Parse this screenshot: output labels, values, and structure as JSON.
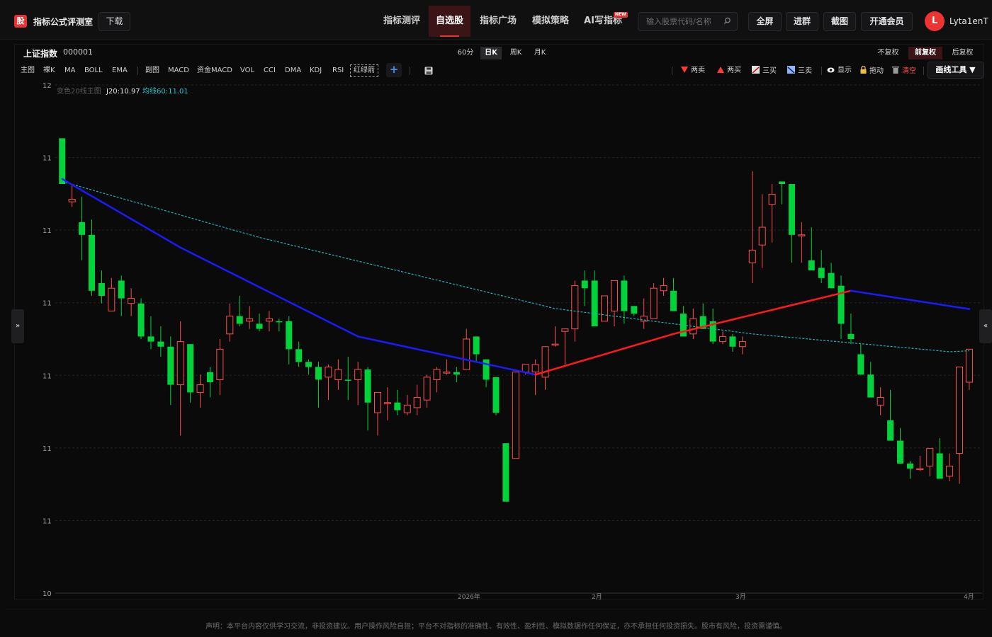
{
  "brand": {
    "badge": "股",
    "name": "指标公式评测室"
  },
  "download_label": "下载",
  "nav": [
    {
      "label": "指标测评",
      "active": false
    },
    {
      "label": "自选股",
      "active": true
    },
    {
      "label": "指标广场",
      "active": false
    },
    {
      "label": "模拟策略",
      "active": false
    },
    {
      "label": "AI写指标",
      "active": false,
      "badge": "NEW"
    }
  ],
  "search": {
    "placeholder": "输入股票代码/名称"
  },
  "actions": [
    "全屏",
    "进群",
    "截图",
    "开通会员"
  ],
  "user": {
    "initial": "L",
    "name": "Lyta1enT"
  },
  "stock": {
    "name": "上证指数",
    "code": "000001"
  },
  "periods": [
    {
      "label": "60分",
      "active": false
    },
    {
      "label": "日K",
      "active": true
    },
    {
      "label": "周K",
      "active": false
    },
    {
      "label": "月K",
      "active": false
    }
  ],
  "adjust": [
    {
      "label": "不复权",
      "active": false
    },
    {
      "label": "前复权",
      "active": true
    },
    {
      "label": "后复权",
      "active": false
    }
  ],
  "indicators_main": [
    "主图",
    "裸K",
    "MA",
    "BOLL",
    "EMA"
  ],
  "indicators_sub": [
    "副图",
    "MACD",
    "资金MACD",
    "VOL",
    "CCI",
    "DMA",
    "KDJ",
    "RSI"
  ],
  "indicator_highlight": "红绿箭",
  "signal_tools": [
    {
      "label": "两卖",
      "icon": "down-triangle-icon",
      "color": "#ff3b30"
    },
    {
      "label": "两买",
      "icon": "up-triangle-icon",
      "color": "#ff3b30"
    },
    {
      "label": "三买",
      "icon": "line-up-icon",
      "color": "#e0e0e0"
    },
    {
      "label": "三卖",
      "icon": "line-down-icon",
      "color": "#8fb5ff"
    },
    {
      "label": "显示",
      "icon": "eye-icon",
      "color": "#ffffff"
    },
    {
      "label": "拖动",
      "icon": "lock-icon",
      "color": "#f0c040"
    },
    {
      "label": "清空",
      "icon": "trash-icon",
      "color": "#9a9a9a",
      "text_color": "#ff5050"
    }
  ],
  "draw_tools_label": "画线工具 ▼",
  "legend": {
    "name": "变色20线主图",
    "j20": "J20:10.97",
    "ma60": "均线60:11.01"
  },
  "colors": {
    "up": "#ff4d4d",
    "down": "#00d43a",
    "accent": "#e63232",
    "ma20_blue": "#1a1aff",
    "ma20_red": "#ff1a1a",
    "ma60": "#1bb5b5"
  },
  "disclaimer": "声明：本平台内容仅供学习交流，非投资建议。用户操作风险自担；平台不对指标的准确性、有效性、盈利性、模拟数据作任何保证，亦不承担任何投资损失。股市有风险，投资需谨慎。",
  "chart_data": {
    "type": "candlestick",
    "y_ticks": [
      "12",
      "11",
      "11",
      "11",
      "11",
      "11",
      "11",
      "10"
    ],
    "x_ticks": [
      "2026年",
      "2月",
      "3月",
      "4月"
    ],
    "ylim": [
      10,
      12
    ],
    "candles": [
      [
        11.61,
        11.61,
        11.77,
        11.79,
        0
      ],
      [
        11.55,
        11.61,
        11.52,
        11.54,
        1
      ],
      [
        11.46,
        11.56,
        11.31,
        11.41,
        0
      ],
      [
        11.41,
        11.47,
        11.17,
        11.19,
        0
      ],
      [
        11.22,
        11.27,
        11.14,
        11.17,
        0
      ],
      [
        11.2,
        11.24,
        11.11,
        11.11,
        1
      ],
      [
        11.23,
        11.25,
        11.09,
        11.16,
        0
      ],
      [
        11.16,
        11.2,
        11.09,
        11.14,
        1
      ],
      [
        11.14,
        11.16,
        11.0,
        11.01,
        0
      ],
      [
        11.01,
        11.09,
        10.96,
        10.99,
        0
      ],
      [
        10.99,
        11.05,
        10.93,
        10.97,
        0
      ],
      [
        10.97,
        11.01,
        10.74,
        10.82,
        0
      ],
      [
        10.82,
        11.07,
        10.62,
        10.99,
        1
      ],
      [
        10.98,
        10.98,
        10.75,
        10.79,
        0
      ],
      [
        10.79,
        10.86,
        10.73,
        10.82,
        1
      ],
      [
        10.87,
        10.89,
        10.77,
        10.83,
        0
      ],
      [
        10.84,
        11.0,
        10.78,
        10.96,
        1
      ],
      [
        11.02,
        11.14,
        10.99,
        11.09,
        1
      ],
      [
        11.09,
        11.17,
        11.05,
        11.06,
        0
      ],
      [
        11.07,
        11.13,
        11.04,
        11.08,
        1
      ],
      [
        11.06,
        11.1,
        11.03,
        11.04,
        0
      ],
      [
        11.07,
        11.11,
        11.03,
        11.08,
        1
      ],
      [
        11.07,
        11.08,
        11.03,
        11.07,
        0
      ],
      [
        11.07,
        11.09,
        10.9,
        10.96,
        0
      ],
      [
        10.96,
        10.99,
        10.89,
        10.91,
        0
      ],
      [
        10.91,
        10.92,
        10.86,
        10.89,
        0
      ],
      [
        10.89,
        10.91,
        10.73,
        10.84,
        0
      ],
      [
        10.85,
        10.9,
        10.76,
        10.89,
        1
      ],
      [
        10.88,
        10.92,
        10.8,
        10.84,
        1
      ],
      [
        10.84,
        10.93,
        10.76,
        10.84,
        0
      ],
      [
        10.84,
        10.91,
        10.74,
        10.88,
        1
      ],
      [
        10.88,
        10.89,
        10.64,
        10.75,
        0
      ],
      [
        10.71,
        10.75,
        10.62,
        10.79,
        1
      ],
      [
        10.75,
        10.81,
        10.68,
        10.75,
        1
      ],
      [
        10.75,
        10.8,
        10.7,
        10.72,
        0
      ],
      [
        10.71,
        10.78,
        10.7,
        10.74,
        1
      ],
      [
        10.73,
        10.82,
        10.7,
        10.77,
        1
      ],
      [
        10.76,
        10.86,
        10.73,
        10.85,
        1
      ],
      [
        10.84,
        10.89,
        10.79,
        10.88,
        1
      ],
      [
        10.87,
        10.92,
        10.86,
        10.87,
        1
      ],
      [
        10.87,
        10.89,
        10.83,
        10.86,
        0
      ],
      [
        10.88,
        11.04,
        10.88,
        11.0,
        1
      ],
      [
        11.01,
        11.01,
        10.91,
        10.94,
        0
      ],
      [
        10.92,
        10.92,
        10.81,
        10.84,
        0
      ],
      [
        10.85,
        10.85,
        10.7,
        10.71,
        0
      ],
      [
        10.59,
        10.59,
        10.36,
        10.36,
        0
      ],
      [
        10.53,
        10.87,
        10.53,
        10.87,
        1
      ],
      [
        10.87,
        10.9,
        10.86,
        10.9,
        1
      ],
      [
        10.87,
        10.92,
        10.78,
        10.9,
        1
      ],
      [
        10.85,
        10.94,
        10.8,
        10.97,
        1
      ],
      [
        10.98,
        11.05,
        10.97,
        10.98,
        1
      ],
      [
        11.03,
        11.03,
        10.9,
        11.04,
        1
      ],
      [
        11.04,
        11.23,
        10.99,
        11.21,
        1
      ],
      [
        11.2,
        11.27,
        11.13,
        11.23,
        0
      ],
      [
        11.23,
        11.27,
        11.05,
        11.05,
        0
      ],
      [
        11.07,
        11.17,
        11.1,
        11.17,
        1
      ],
      [
        11.11,
        11.19,
        11.05,
        11.23,
        1
      ],
      [
        11.23,
        11.25,
        11.06,
        11.11,
        0
      ],
      [
        11.13,
        11.1,
        11.09,
        11.1,
        0
      ],
      [
        11.09,
        11.16,
        11.04,
        11.07,
        1
      ],
      [
        11.08,
        11.22,
        11.09,
        11.2,
        1
      ],
      [
        11.21,
        11.24,
        11.17,
        11.19,
        1
      ],
      [
        11.19,
        11.24,
        11.13,
        11.11,
        0
      ],
      [
        11.1,
        11.13,
        11.04,
        11.01,
        0
      ],
      [
        11.02,
        11.12,
        11.0,
        11.08,
        1
      ],
      [
        11.09,
        11.14,
        11.04,
        11.04,
        0
      ],
      [
        11.07,
        11.12,
        10.98,
        10.99,
        0
      ],
      [
        10.99,
        11.03,
        10.98,
        11.01,
        1
      ],
      [
        11.01,
        11.02,
        10.95,
        10.97,
        0
      ],
      [
        10.97,
        11.01,
        10.94,
        10.99,
        1
      ],
      [
        11.35,
        11.66,
        11.22,
        11.3,
        1
      ],
      [
        11.37,
        11.57,
        11.28,
        11.44,
        1
      ],
      [
        11.57,
        11.61,
        11.38,
        11.53,
        1
      ],
      [
        11.62,
        11.62,
        11.53,
        11.61,
        0
      ],
      [
        11.61,
        11.59,
        11.3,
        11.41,
        0
      ],
      [
        11.41,
        11.46,
        11.3,
        11.41,
        1
      ],
      [
        11.31,
        11.44,
        11.28,
        11.27,
        0
      ],
      [
        11.28,
        11.35,
        11.22,
        11.24,
        0
      ],
      [
        11.26,
        11.3,
        11.22,
        11.2,
        0
      ],
      [
        11.21,
        11.25,
        11.0,
        11.06,
        0
      ],
      [
        11.02,
        11.1,
        10.98,
        11.0,
        0
      ],
      [
        10.94,
        10.98,
        10.87,
        10.86,
        0
      ],
      [
        10.86,
        10.91,
        10.78,
        10.77,
        0
      ],
      [
        10.77,
        10.81,
        10.7,
        10.74,
        1
      ],
      [
        10.68,
        10.8,
        10.6,
        10.6,
        0
      ],
      [
        10.6,
        10.65,
        10.55,
        10.51,
        0
      ],
      [
        10.51,
        10.52,
        10.45,
        10.49,
        0
      ],
      [
        10.49,
        10.54,
        10.48,
        10.49,
        1
      ],
      [
        10.5,
        10.56,
        10.46,
        10.57,
        1
      ],
      [
        10.55,
        10.61,
        10.45,
        10.45,
        0
      ],
      [
        10.46,
        10.55,
        10.44,
        10.5,
        1
      ],
      [
        10.55,
        10.85,
        10.43,
        10.89,
        1
      ],
      [
        10.83,
        10.92,
        10.8,
        10.96,
        1
      ]
    ],
    "ma20": [
      [
        0,
        11.63
      ],
      [
        12,
        11.36
      ],
      [
        30,
        11.01
      ],
      [
        48,
        10.86
      ],
      [
        62,
        11.02
      ],
      [
        80,
        11.19
      ],
      [
        95,
        11.1
      ],
      [
        106,
        11.0
      ]
    ],
    "ma60": [
      [
        0,
        11.62
      ],
      [
        20,
        11.4
      ],
      [
        50,
        11.12
      ],
      [
        70,
        11.02
      ],
      [
        90,
        10.95
      ],
      [
        106,
        10.98
      ]
    ]
  }
}
